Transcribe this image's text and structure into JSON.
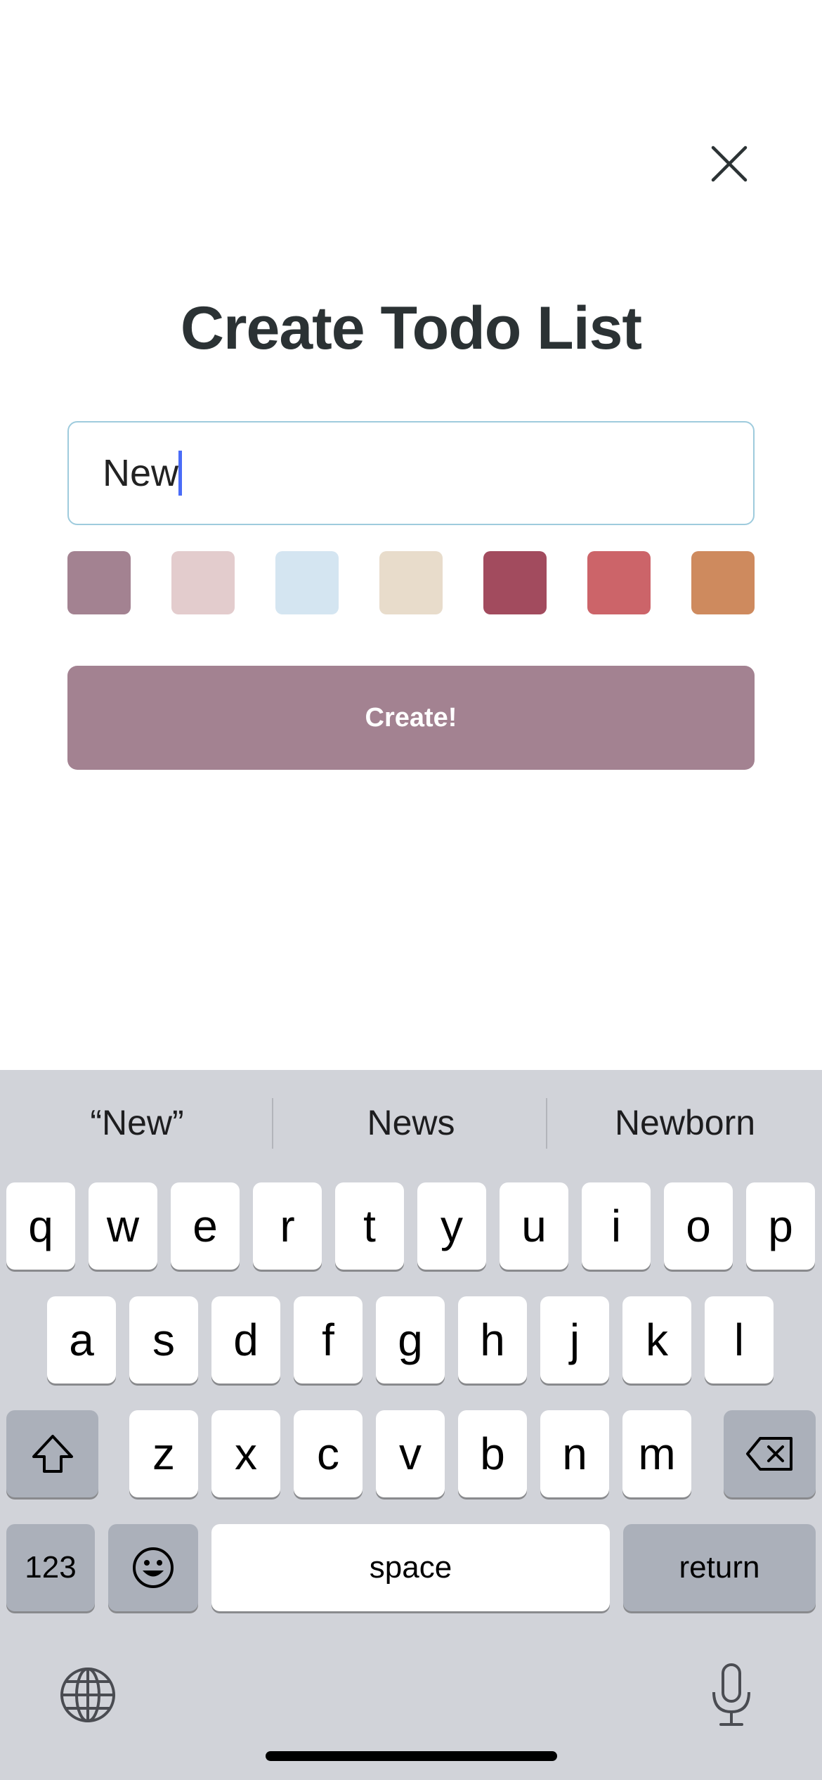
{
  "header": {
    "close_icon": "close-icon",
    "title": "Create Todo List"
  },
  "form": {
    "name_value": "New",
    "swatches": [
      {
        "color": "#a38291"
      },
      {
        "color": "#e3cccd"
      },
      {
        "color": "#d4e5f1"
      },
      {
        "color": "#e8dccb"
      },
      {
        "color": "#a24b5e"
      },
      {
        "color": "#cc6469"
      },
      {
        "color": "#ce8a5e"
      }
    ],
    "create_label": "Create!",
    "accent_color": "#a38291"
  },
  "keyboard": {
    "suggestions": [
      "“New”",
      "News",
      "Newborn"
    ],
    "row1": [
      "q",
      "w",
      "e",
      "r",
      "t",
      "y",
      "u",
      "i",
      "o",
      "p"
    ],
    "row2": [
      "a",
      "s",
      "d",
      "f",
      "g",
      "h",
      "j",
      "k",
      "l"
    ],
    "row3": [
      "z",
      "x",
      "c",
      "v",
      "b",
      "n",
      "m"
    ],
    "numbers_label": "123",
    "space_label": "space",
    "return_label": "return",
    "icons": [
      "shift-icon",
      "delete-icon",
      "emoji-icon",
      "globe-icon",
      "microphone-icon"
    ]
  }
}
